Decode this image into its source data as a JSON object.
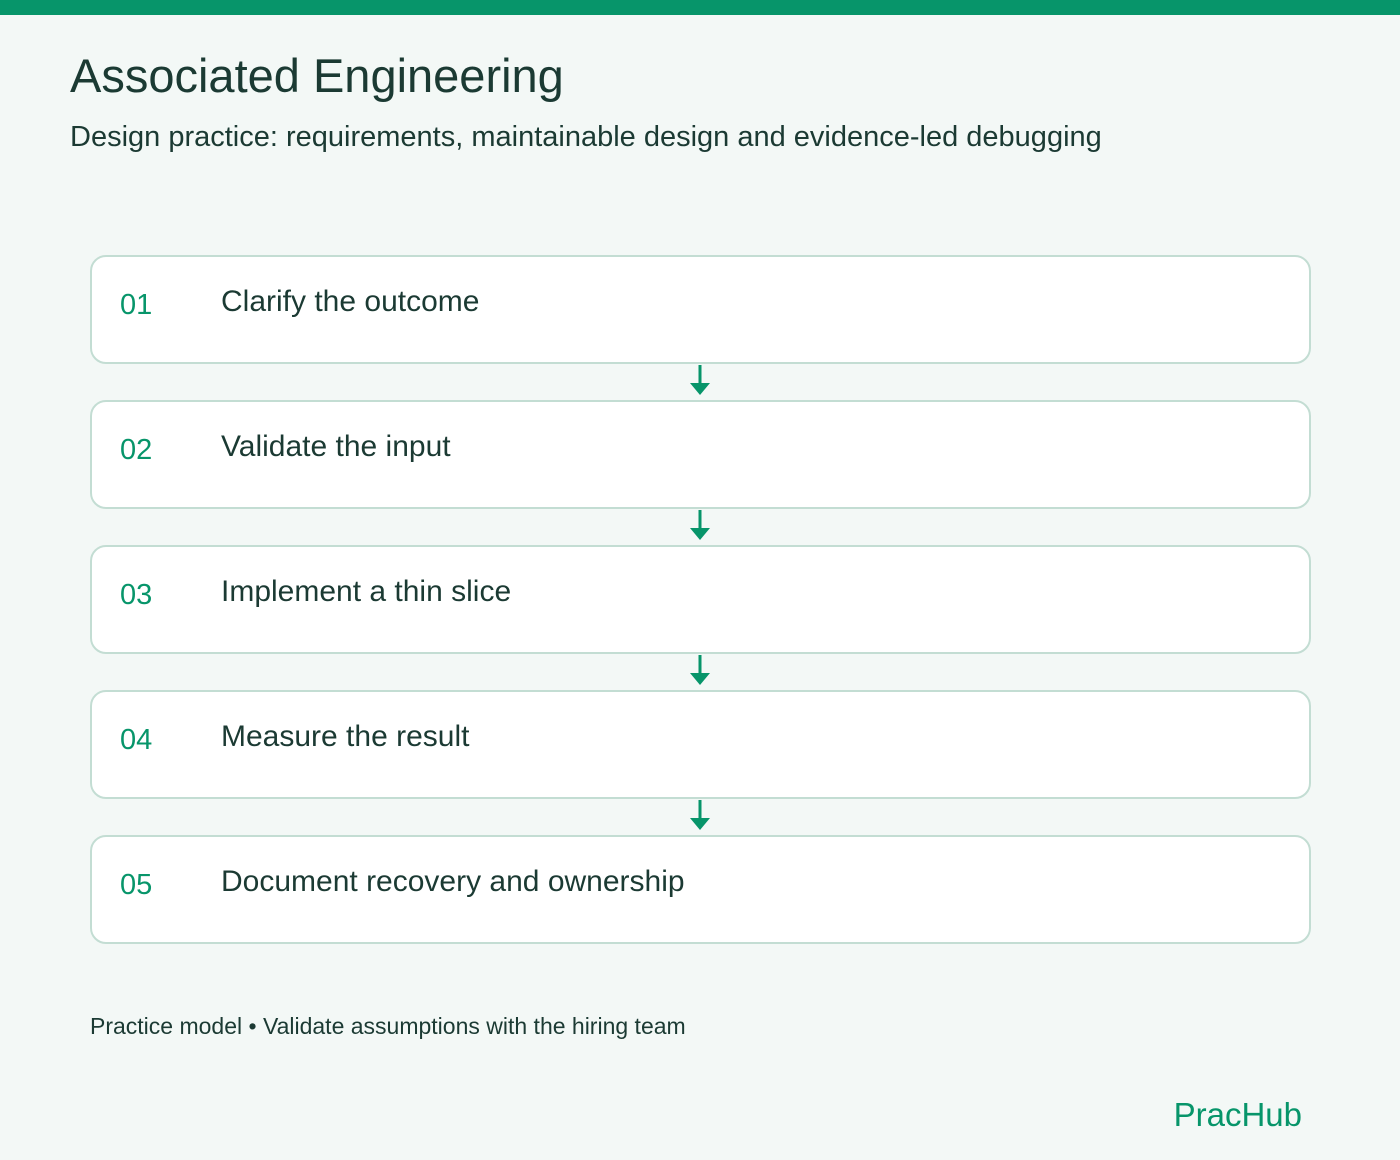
{
  "header": {
    "title": "Associated Engineering",
    "subtitle": "Design practice: requirements, maintainable design and evidence-led debugging"
  },
  "steps": [
    {
      "number": "01",
      "label": "Clarify the outcome"
    },
    {
      "number": "02",
      "label": "Validate the input"
    },
    {
      "number": "03",
      "label": "Implement a thin slice"
    },
    {
      "number": "04",
      "label": "Measure the result"
    },
    {
      "number": "05",
      "label": "Document recovery and ownership"
    }
  ],
  "footer": {
    "note": "Practice model • Validate assumptions with the hiring team",
    "brand": "PracHub"
  },
  "colors": {
    "accent": "#07956a",
    "text": "#1b3a33",
    "background": "#f3f8f6",
    "card_border": "#c3ddd3"
  },
  "icons": {
    "connector": "arrow-down-icon"
  }
}
